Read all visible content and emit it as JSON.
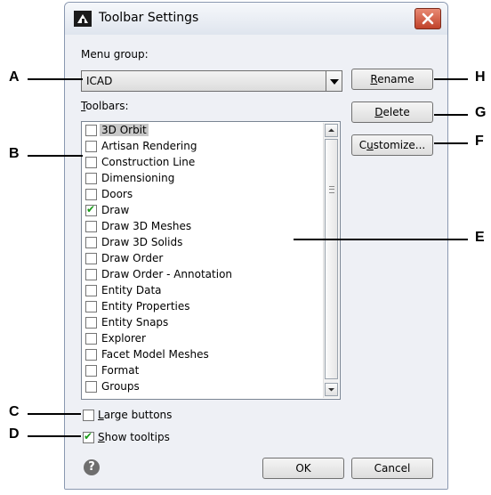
{
  "window": {
    "title": "Toolbar Settings"
  },
  "menu_group": {
    "label": "Menu group:",
    "value": "ICAD"
  },
  "toolbars": {
    "label_underlined": "T",
    "label_rest": "oolbars:",
    "items": [
      {
        "label": "3D Orbit",
        "checked": false,
        "selected": true
      },
      {
        "label": "Artisan Rendering",
        "checked": false
      },
      {
        "label": "Construction Line",
        "checked": false
      },
      {
        "label": "Dimensioning",
        "checked": false
      },
      {
        "label": "Doors",
        "checked": false
      },
      {
        "label": "Draw",
        "checked": true
      },
      {
        "label": "Draw 3D Meshes",
        "checked": false
      },
      {
        "label": "Draw 3D Solids",
        "checked": false
      },
      {
        "label": "Draw Order",
        "checked": false
      },
      {
        "label": "Draw Order - Annotation",
        "checked": false
      },
      {
        "label": "Entity Data",
        "checked": false
      },
      {
        "label": "Entity Properties",
        "checked": false
      },
      {
        "label": "Entity Snaps",
        "checked": false
      },
      {
        "label": "Explorer",
        "checked": false
      },
      {
        "label": "Facet Model Meshes",
        "checked": false
      },
      {
        "label": "Format",
        "checked": false
      },
      {
        "label": "Groups",
        "checked": false
      }
    ]
  },
  "buttons": {
    "rename_u": "R",
    "rename_rest": "ename",
    "delete_u": "D",
    "delete_rest": "elete",
    "customize_pre": "C",
    "customize_u": "u",
    "customize_rest": "stomize...",
    "ok": "OK",
    "cancel": "Cancel"
  },
  "options": {
    "large_u": "L",
    "large_rest": "arge buttons",
    "large_checked": false,
    "tooltips_u": "S",
    "tooltips_rest": "how tooltips",
    "tooltips_checked": true
  },
  "help_icon": "?",
  "callouts": [
    "A",
    "B",
    "C",
    "D",
    "E",
    "F",
    "G",
    "H"
  ]
}
